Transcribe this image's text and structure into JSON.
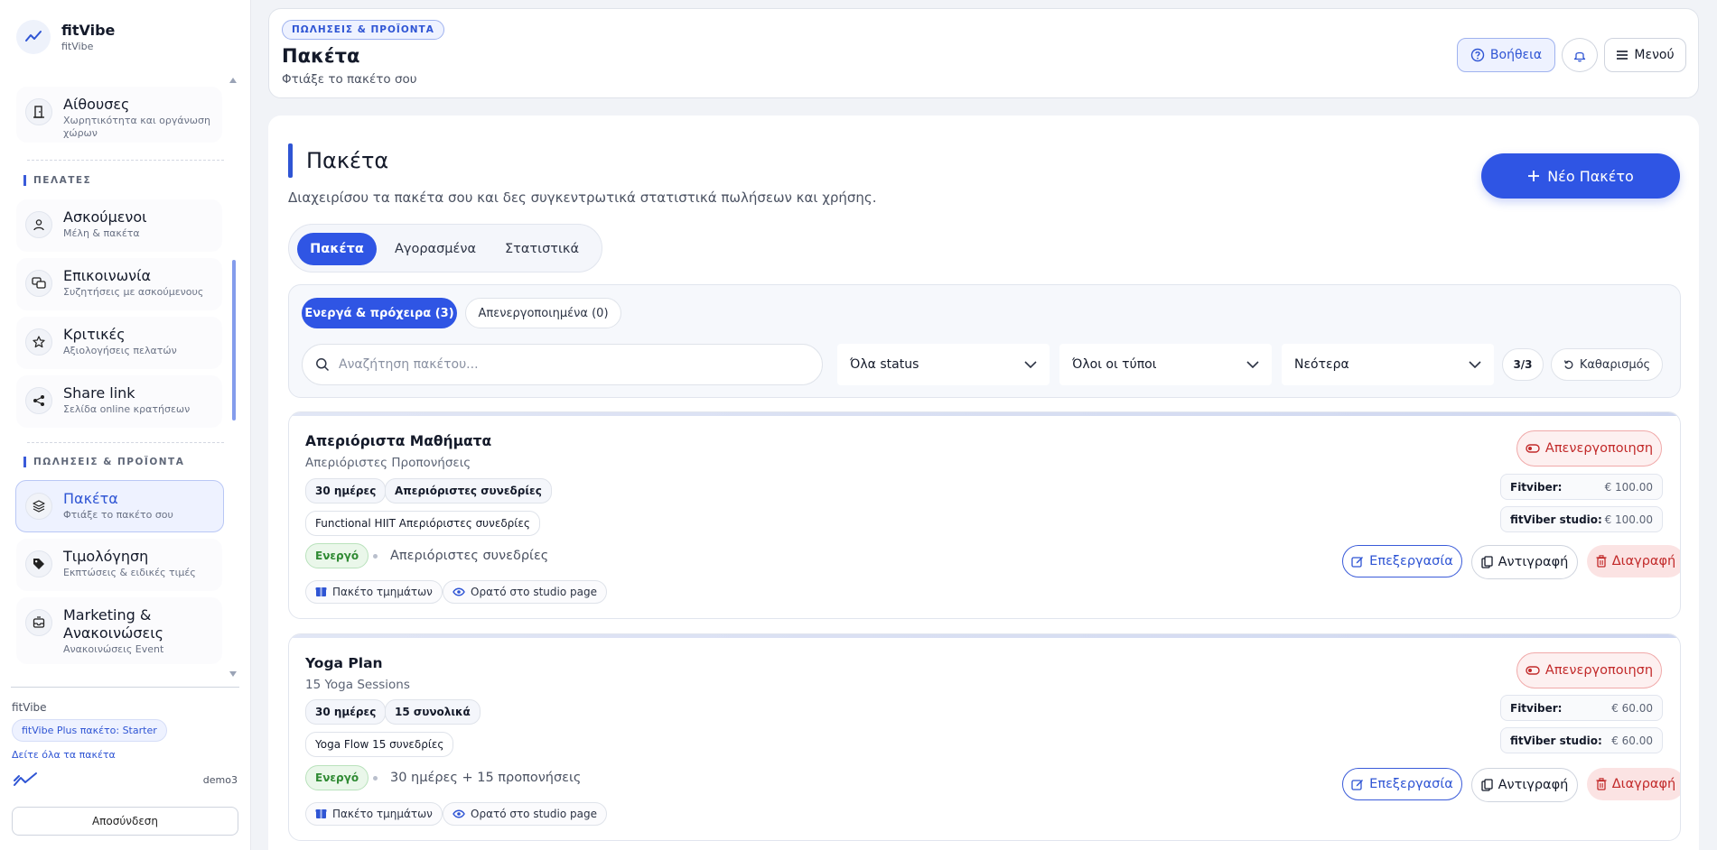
{
  "brand": {
    "name": "fitVibe",
    "sub": "fitVibe"
  },
  "sidebar": {
    "top_item": {
      "title": "Αίθουσες",
      "sub_line1": "Χωρητικότητα και οργάνωση",
      "sub_line2": "χώρων"
    },
    "section_clients": "ΠΕΛΑΤΕΣ",
    "clients_items": [
      {
        "title": "Ασκούμενοι",
        "sub": "Μέλη & πακέτα",
        "icon": "user-icon"
      },
      {
        "title": "Επικοινωνία",
        "sub": "Συζητήσεις με ασκούμενους",
        "icon": "chat-icon"
      },
      {
        "title": "Κριτικές",
        "sub": "Αξιολογήσεις πελατών",
        "icon": "star-icon"
      },
      {
        "title": "Share link",
        "sub": "Σελίδα online κρατήσεων",
        "icon": "share-icon"
      }
    ],
    "section_sales": "ΠΩΛΗΣΕΙΣ & ΠΡΟΪΟΝΤΑ",
    "sales_items": [
      {
        "title": "Πακέτα",
        "sub": "Φτιάξε το πακέτο σου",
        "icon": "layers-icon",
        "active": true
      },
      {
        "title": "Τιμολόγηση",
        "sub": "Εκπτώσεις & ειδικές τιμές",
        "icon": "tag-icon"
      },
      {
        "title_line1": "Marketing &",
        "title_line2": "Ανακοινώσεις",
        "sub": "Ανακοινώσεις Event",
        "icon": "inbox-icon"
      }
    ],
    "footer": {
      "title": "fitVibe",
      "plan": "fitVibe Plus πακέτο: Starter",
      "plans_link": "Δείτε όλα τα πακέτα",
      "user": "demo3",
      "logout": "Αποσύνδεση"
    }
  },
  "header": {
    "breadcrumb": "ΠΩΛΗΣΕΙΣ & ΠΡΟΪΟΝΤΑ",
    "title": "Πακέτα",
    "subtitle": "Φτιάξε το πακέτο σου",
    "help": "Βοήθεια",
    "menu": "Μενού"
  },
  "main": {
    "title": "Πακέτα",
    "subtitle": "Διαχειρίσου τα πακέτα σου και δες συγκεντρωτικά στατιστικά πωλήσεων και χρήσης.",
    "new_button": "Νέο Πακέτο",
    "tabs": [
      "Πακέτα",
      "Αγορασμένα",
      "Στατιστικά"
    ],
    "filters": {
      "active_seg": "Ενεργά & πρόχειρα (3)",
      "inactive_seg": "Απενεργοποιημένα (0)",
      "search_placeholder": "Αναζήτηση πακέτου...",
      "status": "Όλα status",
      "types": "Όλοι οι τύποι",
      "sort": "Νεότερα",
      "count": "3/3",
      "clear": "Καθαρισμός"
    },
    "packages": [
      {
        "name": "Απεριόριστα Μαθήματα",
        "desc": "Απεριόριστες Προπονήσεις",
        "chip1": "30 ημέρες",
        "chip2": "Απεριόριστες συνεδρίες",
        "chip3": "Functional HIIT Απεριόριστες συνεδρίες",
        "status": "Ενεργό",
        "usage": "Απεριόριστες συνεδρίες",
        "tag1": "Πακέτο τμημάτων",
        "tag2": "Ορατό στο studio page",
        "deactivate": "Απενεργοποιηση",
        "prices": [
          {
            "label": "Fitviber:",
            "value": "€ 100.00"
          },
          {
            "label": "fitViber studio:",
            "value": "€ 100.00"
          }
        ],
        "edit": "Επεξεργασία",
        "copy": "Αντιγραφή",
        "delete": "Διαγραφή"
      },
      {
        "name": "Yoga Plan",
        "desc": "15 Yoga Sessions",
        "chip1": "30 ημέρες",
        "chip2": "15 συνολικά",
        "chip3": "Yoga Flow 15 συνεδρίες",
        "status": "Ενεργό",
        "usage": "30 ημέρες + 15 προπονήσεις",
        "tag1": "Πακέτο τμημάτων",
        "tag2": "Ορατό στο studio page",
        "deactivate": "Απενεργοποιηση",
        "prices": [
          {
            "label": "Fitviber:",
            "value": "€ 60.00"
          },
          {
            "label": "fitViber studio:",
            "value": "€ 60.00"
          }
        ],
        "edit": "Επεξεργασία",
        "copy": "Αντιγραφή",
        "delete": "Διαγραφή"
      }
    ]
  },
  "colors": {
    "accent": "#2f55e4",
    "danger": "#c22a2a",
    "success": "#2f8a33"
  }
}
